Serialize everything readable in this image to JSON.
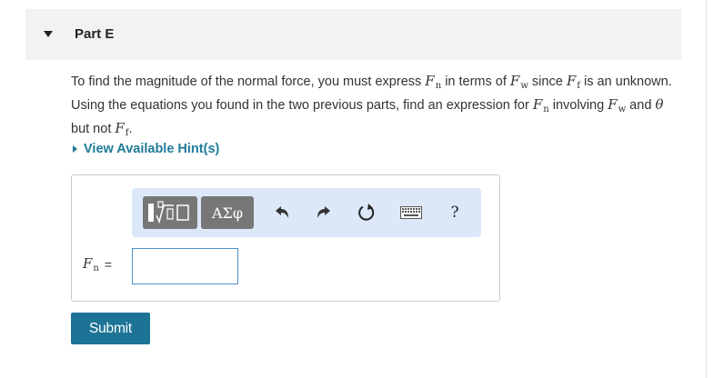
{
  "part": {
    "title": "Part E"
  },
  "problem": {
    "t1": "To find the magnitude of the normal force, you must express ",
    "t2": " in terms of ",
    "t3": " since ",
    "t4": " is an unknown. Using the equations you found in the two previous parts, find an expression for ",
    "t5": " involving ",
    "t6": " and ",
    "t7": " but not ",
    "t8": ".",
    "var_F": "F",
    "sub_n": "n",
    "sub_w": "w",
    "sub_f": "f",
    "theta": "θ"
  },
  "hint": {
    "label": "View Available Hint(s)"
  },
  "toolbar": {
    "greek_label": "ΑΣφ",
    "help_label": "?",
    "icons": [
      "templates-icon",
      "greek-letters-icon",
      "undo-icon",
      "redo-icon",
      "reset-icon",
      "keyboard-icon",
      "help-icon"
    ]
  },
  "equation": {
    "var": "F",
    "sub": "n",
    "equals": "="
  },
  "input": {
    "value": ""
  },
  "submit": {
    "label": "Submit"
  },
  "colors": {
    "accent": "#1d7396",
    "hint": "#1f7a99",
    "toolbar_bg": "#dce8f8",
    "input_border": "#4e90c8"
  }
}
